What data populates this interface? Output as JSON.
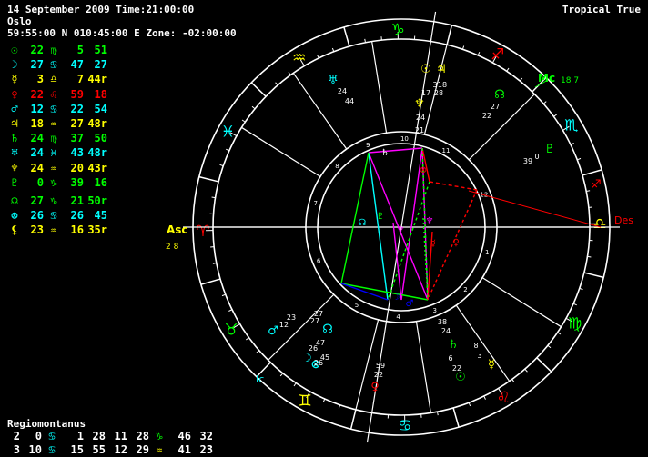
{
  "header": {
    "line1": "14 September 2009 Time:21:00:00",
    "line2": "Oslo",
    "line3": "59:55:00 N 010:45:00 E Zone: -02:00:00",
    "mode": "Tropical True"
  },
  "planets": [
    {
      "glyph": "☉",
      "deg": "22",
      "sign": "♍",
      "min": "5",
      "sec": "51",
      "color": "#00ff00",
      "sign_color": "#00ff00"
    },
    {
      "glyph": "☽",
      "deg": "27",
      "sign": "♋",
      "min": "47",
      "sec": "27",
      "color": "#00ffff",
      "sign_color": "#00ffff"
    },
    {
      "glyph": "☿",
      "deg": "3",
      "sign": "♎",
      "min": "7",
      "sec": "44r",
      "color": "#ffff00",
      "sign_color": "#ffff00"
    },
    {
      "glyph": "♀",
      "deg": "22",
      "sign": "♌",
      "min": "59",
      "sec": "18",
      "color": "#ff0000",
      "sign_color": "#ff0000"
    },
    {
      "glyph": "♂",
      "deg": "12",
      "sign": "♋",
      "min": "22",
      "sec": "54",
      "color": "#00ffff",
      "sign_color": "#00ffff"
    },
    {
      "glyph": "♃",
      "deg": "18",
      "sign": "♒",
      "min": "27",
      "sec": "48r",
      "color": "#ffff00",
      "sign_color": "#ffff00"
    },
    {
      "glyph": "♄",
      "deg": "24",
      "sign": "♍",
      "min": "37",
      "sec": "50",
      "color": "#00ff00",
      "sign_color": "#00ff00"
    },
    {
      "glyph": "♅",
      "deg": "24",
      "sign": "♓",
      "min": "43",
      "sec": "48r",
      "color": "#00ffff",
      "sign_color": "#00ffff"
    },
    {
      "glyph": "♆",
      "deg": "24",
      "sign": "♒",
      "min": "20",
      "sec": "43r",
      "color": "#ffff00",
      "sign_color": "#ffff00"
    },
    {
      "glyph": "♇",
      "deg": "0",
      "sign": "♑",
      "min": "39",
      "sec": "16",
      "color": "#00ff00",
      "sign_color": "#00ff00"
    },
    {
      "glyph": "☊",
      "deg": "27",
      "sign": "♑",
      "min": "21",
      "sec": "50r",
      "color": "#00ff00",
      "sign_color": "#00ff00",
      "gap": true
    },
    {
      "glyph": "⊗",
      "deg": "26",
      "sign": "♋",
      "min": "26",
      "sec": "45",
      "color": "#00ffff",
      "sign_color": "#00ffff"
    },
    {
      "glyph": "⚸",
      "deg": "23",
      "sign": "♒",
      "min": "16",
      "sec": "35r",
      "color": "#ffff00",
      "sign_color": "#ffff00"
    }
  ],
  "houses": {
    "system": "Regiomontanus",
    "rows": [
      [
        {
          "t": "2",
          "c": "#ffffff"
        },
        {
          "t": "0",
          "c": "#ffffff"
        },
        {
          "t": "♋",
          "c": "#00ffff"
        },
        {
          "t": "1",
          "c": "#ffffff"
        },
        {
          "t": "28",
          "c": "#ffffff"
        },
        {
          "t": "11",
          "c": "#ffffff"
        },
        {
          "t": "28",
          "c": "#ffffff"
        },
        {
          "t": "♑",
          "c": "#00ff00"
        },
        {
          "t": "46",
          "c": "#ffffff"
        },
        {
          "t": "32",
          "c": "#ffffff"
        }
      ],
      [
        {
          "t": "3",
          "c": "#ffffff"
        },
        {
          "t": "10",
          "c": "#ffffff"
        },
        {
          "t": "♋",
          "c": "#00ffff"
        },
        {
          "t": "15",
          "c": "#ffffff"
        },
        {
          "t": "55",
          "c": "#ffffff"
        },
        {
          "t": "12",
          "c": "#ffffff"
        },
        {
          "t": "29",
          "c": "#ffffff"
        },
        {
          "t": "♒",
          "c": "#ffff00"
        },
        {
          "t": "41",
          "c": "#ffffff"
        },
        {
          "t": "23",
          "c": "#ffffff"
        }
      ]
    ]
  },
  "wheel": {
    "asc_label": "Asc",
    "asc_value": "2 8",
    "des_label": "Des",
    "mc_label": "Mc",
    "mc_value": "18 7",
    "ic_label": "Ic",
    "house_numbers": [
      "1",
      "2",
      "3",
      "4",
      "5",
      "6",
      "7",
      "8",
      "9",
      "10",
      "11",
      "12"
    ],
    "zodiac": [
      {
        "glyph": "♈",
        "color": "#ff0000"
      },
      {
        "glyph": "♉",
        "color": "#00ff00"
      },
      {
        "glyph": "♊",
        "color": "#ffff00"
      },
      {
        "glyph": "♋",
        "color": "#00ffff"
      },
      {
        "glyph": "♌",
        "color": "#ff0000"
      },
      {
        "glyph": "♍",
        "color": "#00ff00"
      },
      {
        "glyph": "♎",
        "color": "#ffff00"
      },
      {
        "glyph": "♏",
        "color": "#00ffff"
      },
      {
        "glyph": "♐",
        "color": "#ff0000"
      },
      {
        "glyph": "♑",
        "color": "#00ff00"
      },
      {
        "glyph": "♒",
        "color": "#ffff00"
      },
      {
        "glyph": "♓",
        "color": "#00ffff"
      }
    ],
    "planet_labels": [
      {
        "text": "24",
        "color": "#ffffff"
      },
      {
        "text": "44",
        "color": "#ffffff"
      },
      {
        "text": "17",
        "color": "#ffffff"
      },
      {
        "text": "28",
        "color": "#ffffff"
      },
      {
        "text": "3",
        "color": "#ffffff"
      },
      {
        "text": "18",
        "color": "#ffffff"
      },
      {
        "text": "24",
        "color": "#ffffff"
      },
      {
        "text": "21",
        "color": "#ffffff"
      },
      {
        "text": "27",
        "color": "#ffffff"
      },
      {
        "text": "22",
        "color": "#ffffff"
      },
      {
        "text": "39",
        "color": "#ffffff"
      },
      {
        "text": "0",
        "color": "#ffffff"
      },
      {
        "text": "12",
        "color": "#ffffff"
      },
      {
        "text": "23",
        "color": "#ffffff"
      },
      {
        "text": "27",
        "color": "#ffffff"
      },
      {
        "text": "27",
        "color": "#ffffff"
      },
      {
        "text": "26",
        "color": "#ffffff"
      },
      {
        "text": "47",
        "color": "#ffffff"
      },
      {
        "text": "26",
        "color": "#ffffff"
      },
      {
        "text": "45",
        "color": "#ffffff"
      },
      {
        "text": "59",
        "color": "#ffffff"
      },
      {
        "text": "22",
        "color": "#ffffff"
      },
      {
        "text": "38",
        "color": "#ffffff"
      },
      {
        "text": "24",
        "color": "#ffffff"
      },
      {
        "text": "6",
        "color": "#ffffff"
      },
      {
        "text": "22",
        "color": "#ffffff"
      },
      {
        "text": "8",
        "color": "#ffffff"
      },
      {
        "text": "3",
        "color": "#ffffff"
      }
    ]
  }
}
